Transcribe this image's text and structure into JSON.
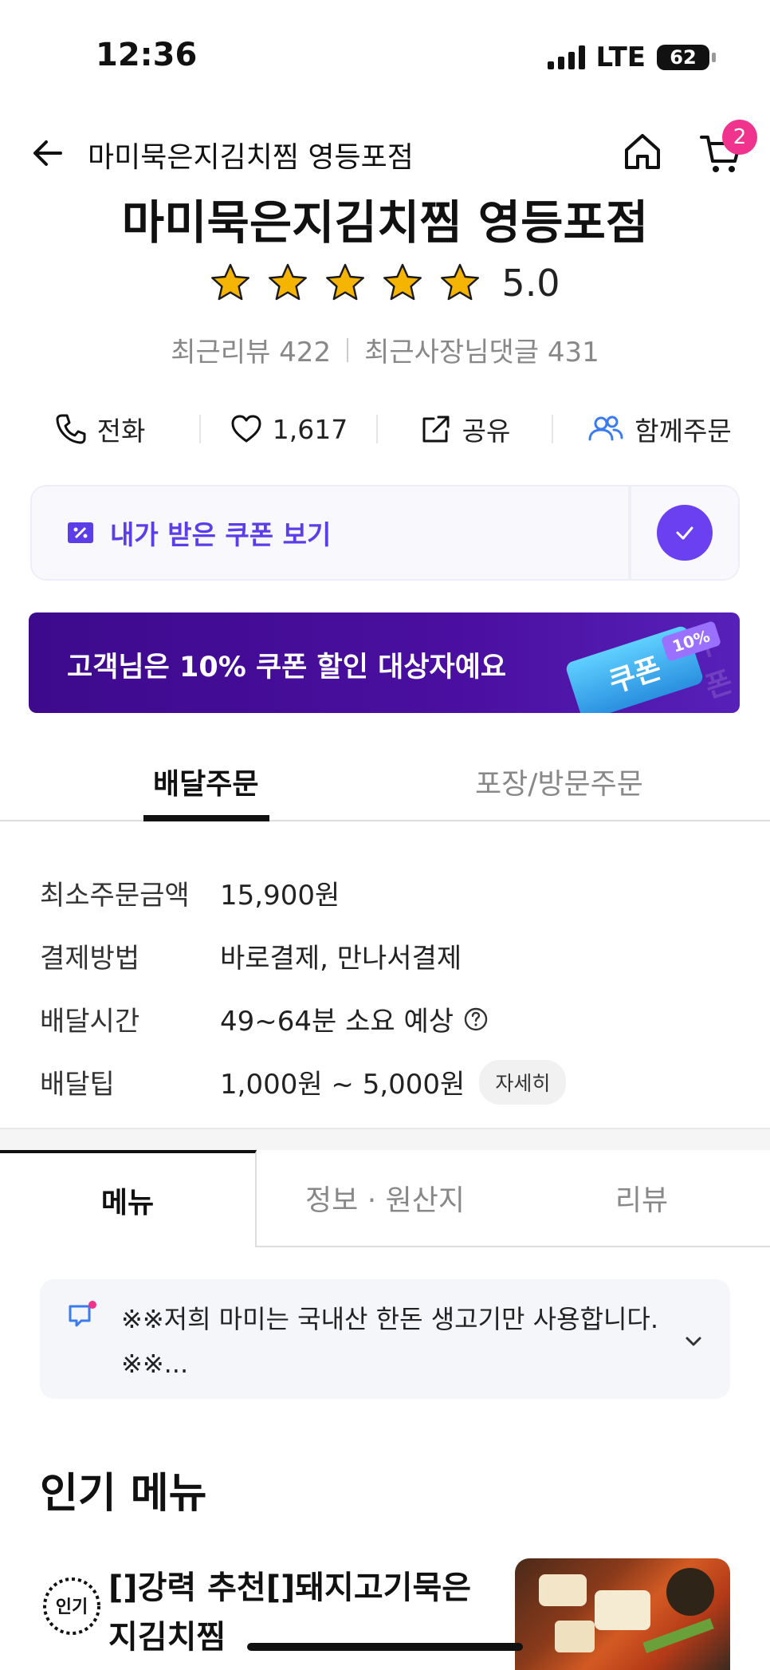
{
  "status": {
    "time": "12:36",
    "network": "LTE",
    "battery": "62"
  },
  "nav": {
    "title": "마미묵은지김치찜 영등포점",
    "cart_count": "2"
  },
  "store": {
    "name": "마미묵은지김치찜 영등포점",
    "rating": "5.0",
    "stars": 5,
    "recent_reviews": "최근리뷰 422",
    "recent_owner_replies": "최근사장님댓글 431"
  },
  "actions": {
    "call": "전화",
    "likes": "1,617",
    "share": "공유",
    "group_order": "함께주문"
  },
  "coupon": {
    "label": "내가 받은 쿠폰 보기"
  },
  "promo": {
    "text": "고객님은 10% 쿠폰 할인 대상자예요",
    "ticket": "쿠폰",
    "percent": "10%",
    "ghost": "쿠폰"
  },
  "order_tabs": {
    "delivery": "배달주문",
    "pickup": "포장/방문주문"
  },
  "info": [
    {
      "key": "최소주문금액",
      "value": "15,900원"
    },
    {
      "key": "결제방법",
      "value": "바로결제, 만나서결제"
    },
    {
      "key": "배달시간",
      "value": "49~64분 소요 예상"
    },
    {
      "key": "배달팁",
      "value": "1,000원 ~ 5,000원",
      "chip": "자세히"
    }
  ],
  "menu_tabs": {
    "menu": "메뉴",
    "info": "정보 · 원산지",
    "review": "리뷰"
  },
  "notice": {
    "text": "※※저희 마미는 국내산 한돈 생고기만 사용합니다. ※※..."
  },
  "popular": {
    "title": "인기 메뉴",
    "badge": "인기",
    "items": [
      {
        "name": "[]강력 추천[]돼지고기묵은지김치찜"
      }
    ]
  },
  "colors": {
    "accent": "#6a40f0",
    "badge": "#f0338c",
    "banner": "#3d0a8c",
    "star": "#f5b400"
  }
}
